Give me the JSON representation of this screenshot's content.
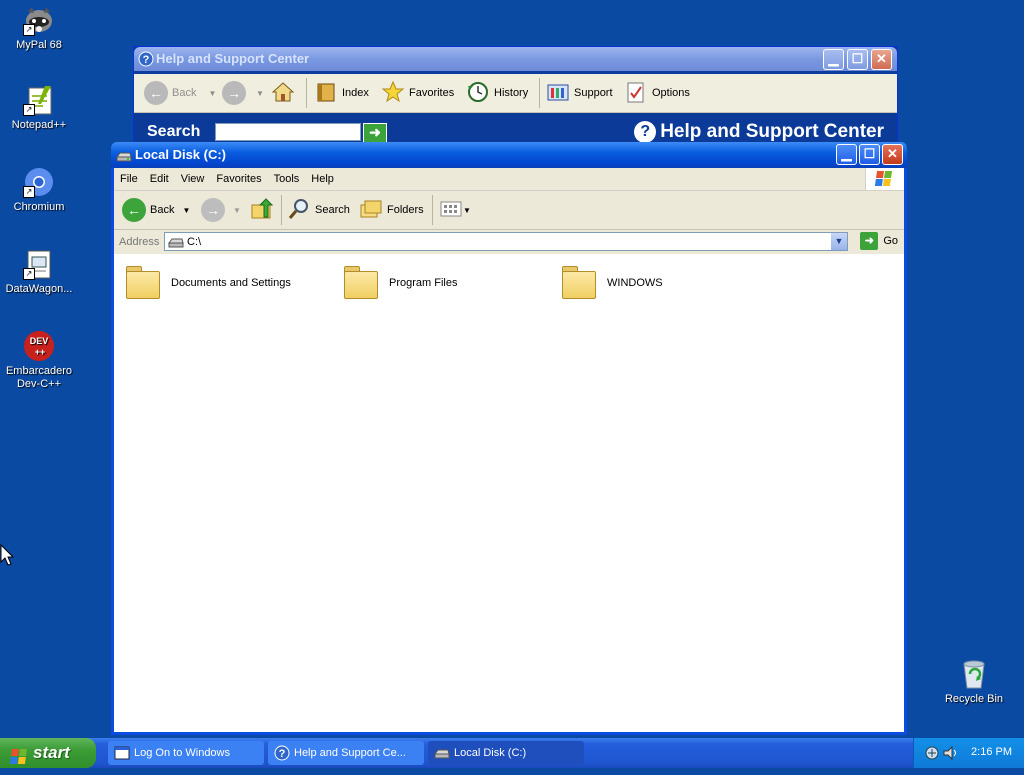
{
  "desktop": {
    "icons": [
      {
        "label": "MyPal 68",
        "icon": "raccoon-icon"
      },
      {
        "label": "Notepad++",
        "icon": "notepad-icon"
      },
      {
        "label": "Chromium",
        "icon": "chromium-icon"
      },
      {
        "label": "DataWagon...",
        "icon": "datawagon-icon"
      },
      {
        "label": "Embarcadero Dev-C++",
        "icon": "devcpp-icon",
        "badge": "DEV"
      },
      {
        "label": "Recycle Bin",
        "icon": "recycle-bin-icon"
      }
    ]
  },
  "help_window": {
    "title": "Help and Support Center",
    "toolbar": {
      "back": "Back",
      "index": "Index",
      "favorites": "Favorites",
      "history": "History",
      "support": "Support",
      "options": "Options"
    },
    "search_label": "Search",
    "banner": "Help and Support Center",
    "search_value": ""
  },
  "explorer": {
    "title": "Local Disk (C:)",
    "menu": [
      "File",
      "Edit",
      "View",
      "Favorites",
      "Tools",
      "Help"
    ],
    "toolbar": {
      "back": "Back",
      "search": "Search",
      "folders": "Folders"
    },
    "address_label": "Address",
    "address_value": "C:\\",
    "go": "Go",
    "folders": [
      "Documents and Settings",
      "Program Files",
      "WINDOWS"
    ]
  },
  "taskbar": {
    "start": "start",
    "tasks": [
      "Log On to Windows",
      "Help and Support Ce...",
      "Local Disk (C:)"
    ],
    "clock": "2:16 PM"
  },
  "colors": {
    "desktop": "#0b4aa3",
    "title_active": "#0a5ee0",
    "taskbar": "#245edb",
    "start": "#3c9c36"
  }
}
